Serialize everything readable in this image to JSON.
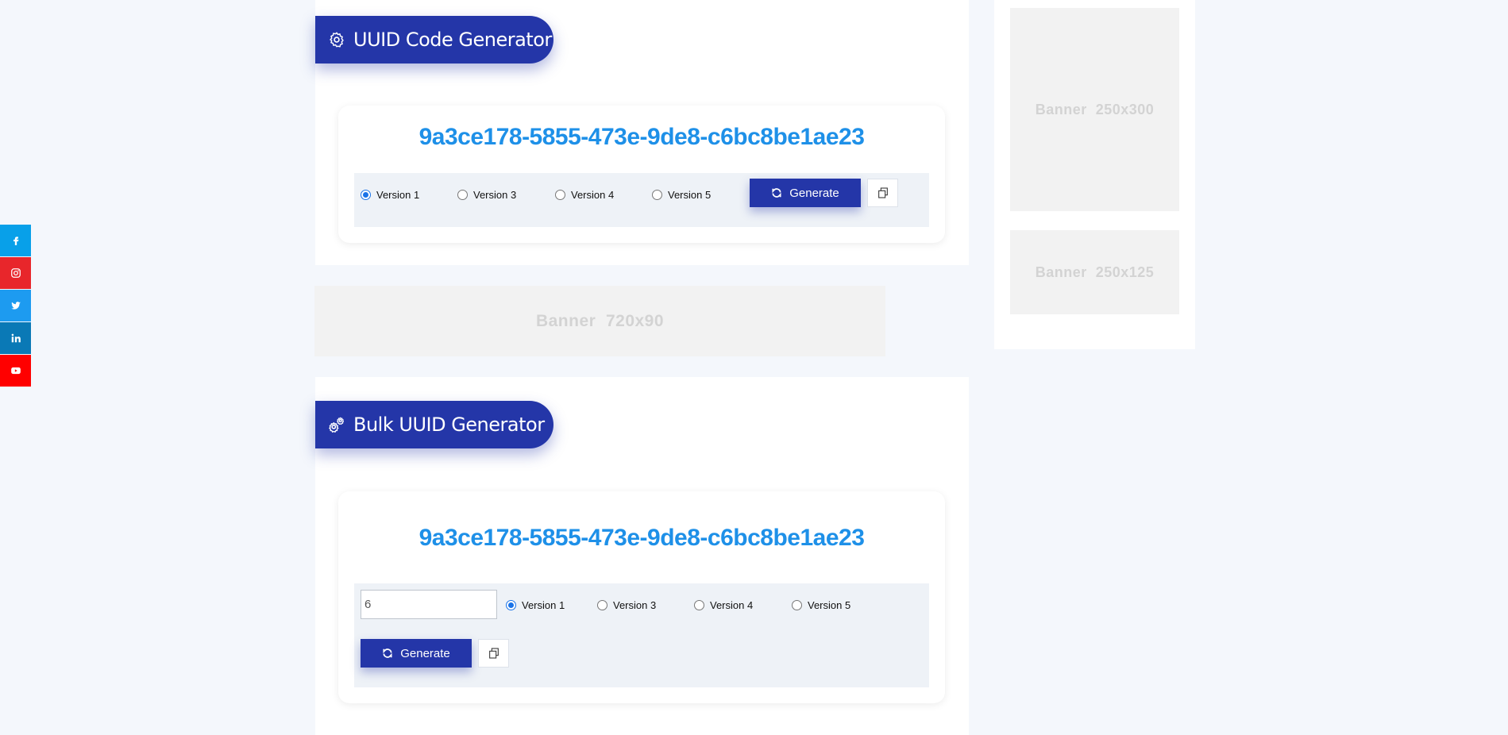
{
  "social": [
    {
      "name": "facebook",
      "icon": "facebook-icon",
      "color": "#08a0e9"
    },
    {
      "name": "instagram",
      "icon": "instagram-icon",
      "color": "#e8262b"
    },
    {
      "name": "twitter",
      "icon": "twitter-icon",
      "color": "#1d9bf0"
    },
    {
      "name": "linkedin",
      "icon": "linkedin-icon",
      "color": "#0a79b6"
    },
    {
      "name": "youtube",
      "icon": "youtube-icon",
      "color": "#ff0000"
    }
  ],
  "single": {
    "title": "UUID Code Generator",
    "title_icon": "gear-icon",
    "uuid": "9a3ce178-5855-473e-9de8-c6bc8be1ae23",
    "versions": [
      "Version 1",
      "Version 3",
      "Version 4",
      "Version 5"
    ],
    "selected_version": "Version 1",
    "generate_label": "Generate",
    "copy_icon": "copy-icon"
  },
  "bulk": {
    "title": "Bulk UUID Generator",
    "title_icon": "gears-icon",
    "uuid": "9a3ce178-5855-473e-9de8-c6bc8be1ae23",
    "count_value": "6",
    "versions": [
      "Version 1",
      "Version 3",
      "Version 4",
      "Version 5"
    ],
    "selected_version": "Version 1",
    "generate_label": "Generate",
    "copy_icon": "copy-icon"
  },
  "banners": {
    "leaderboard": "Banner  720x90",
    "side_large": "Banner  250x300",
    "side_small": "Banner  250x125"
  },
  "colors": {
    "accent": "#2436a8",
    "uuid_text": "#1e90e8",
    "page_bg": "#f4f7fc"
  }
}
